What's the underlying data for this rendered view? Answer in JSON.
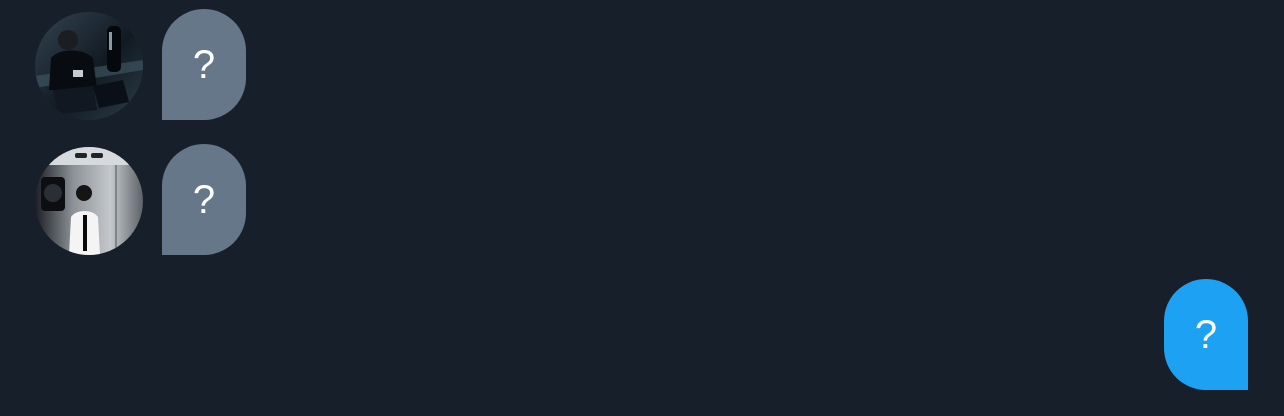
{
  "messages": [
    {
      "direction": "incoming",
      "avatar": "user-avatar-photo-1",
      "text": "?"
    },
    {
      "direction": "incoming",
      "avatar": "user-avatar-photo-2",
      "text": "?"
    },
    {
      "direction": "outgoing",
      "text": "?"
    }
  ],
  "colors": {
    "background": "#17202a",
    "incoming_bubble": "#66778a",
    "outgoing_bubble": "#1da1f2",
    "bubble_text": "#ffffff"
  }
}
